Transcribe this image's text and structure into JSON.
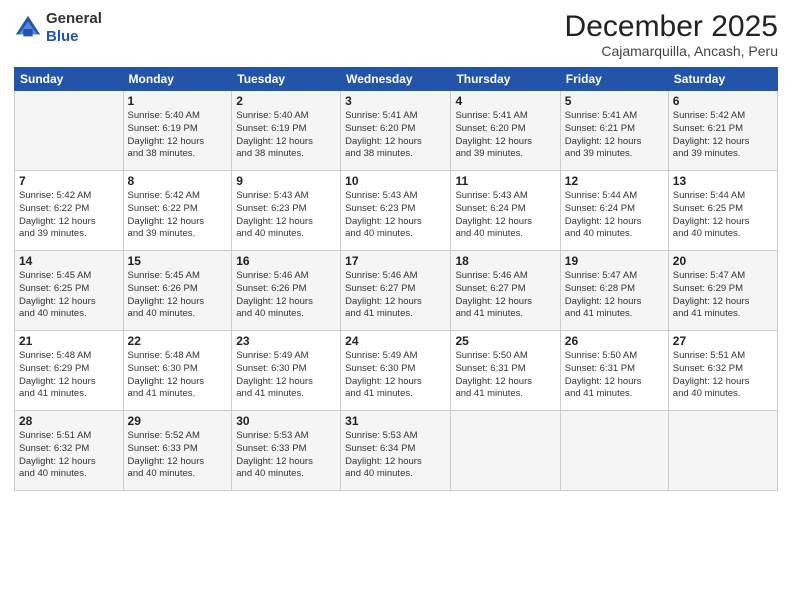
{
  "logo": {
    "general": "General",
    "blue": "Blue"
  },
  "title": "December 2025",
  "location": "Cajamarquilla, Ancash, Peru",
  "days_of_week": [
    "Sunday",
    "Monday",
    "Tuesday",
    "Wednesday",
    "Thursday",
    "Friday",
    "Saturday"
  ],
  "weeks": [
    [
      {
        "day": "",
        "info": ""
      },
      {
        "day": "1",
        "info": "Sunrise: 5:40 AM\nSunset: 6:19 PM\nDaylight: 12 hours\nand 38 minutes."
      },
      {
        "day": "2",
        "info": "Sunrise: 5:40 AM\nSunset: 6:19 PM\nDaylight: 12 hours\nand 38 minutes."
      },
      {
        "day": "3",
        "info": "Sunrise: 5:41 AM\nSunset: 6:20 PM\nDaylight: 12 hours\nand 38 minutes."
      },
      {
        "day": "4",
        "info": "Sunrise: 5:41 AM\nSunset: 6:20 PM\nDaylight: 12 hours\nand 39 minutes."
      },
      {
        "day": "5",
        "info": "Sunrise: 5:41 AM\nSunset: 6:21 PM\nDaylight: 12 hours\nand 39 minutes."
      },
      {
        "day": "6",
        "info": "Sunrise: 5:42 AM\nSunset: 6:21 PM\nDaylight: 12 hours\nand 39 minutes."
      }
    ],
    [
      {
        "day": "7",
        "info": "Sunrise: 5:42 AM\nSunset: 6:22 PM\nDaylight: 12 hours\nand 39 minutes."
      },
      {
        "day": "8",
        "info": "Sunrise: 5:42 AM\nSunset: 6:22 PM\nDaylight: 12 hours\nand 39 minutes."
      },
      {
        "day": "9",
        "info": "Sunrise: 5:43 AM\nSunset: 6:23 PM\nDaylight: 12 hours\nand 40 minutes."
      },
      {
        "day": "10",
        "info": "Sunrise: 5:43 AM\nSunset: 6:23 PM\nDaylight: 12 hours\nand 40 minutes."
      },
      {
        "day": "11",
        "info": "Sunrise: 5:43 AM\nSunset: 6:24 PM\nDaylight: 12 hours\nand 40 minutes."
      },
      {
        "day": "12",
        "info": "Sunrise: 5:44 AM\nSunset: 6:24 PM\nDaylight: 12 hours\nand 40 minutes."
      },
      {
        "day": "13",
        "info": "Sunrise: 5:44 AM\nSunset: 6:25 PM\nDaylight: 12 hours\nand 40 minutes."
      }
    ],
    [
      {
        "day": "14",
        "info": "Sunrise: 5:45 AM\nSunset: 6:25 PM\nDaylight: 12 hours\nand 40 minutes."
      },
      {
        "day": "15",
        "info": "Sunrise: 5:45 AM\nSunset: 6:26 PM\nDaylight: 12 hours\nand 40 minutes."
      },
      {
        "day": "16",
        "info": "Sunrise: 5:46 AM\nSunset: 6:26 PM\nDaylight: 12 hours\nand 40 minutes."
      },
      {
        "day": "17",
        "info": "Sunrise: 5:46 AM\nSunset: 6:27 PM\nDaylight: 12 hours\nand 41 minutes."
      },
      {
        "day": "18",
        "info": "Sunrise: 5:46 AM\nSunset: 6:27 PM\nDaylight: 12 hours\nand 41 minutes."
      },
      {
        "day": "19",
        "info": "Sunrise: 5:47 AM\nSunset: 6:28 PM\nDaylight: 12 hours\nand 41 minutes."
      },
      {
        "day": "20",
        "info": "Sunrise: 5:47 AM\nSunset: 6:29 PM\nDaylight: 12 hours\nand 41 minutes."
      }
    ],
    [
      {
        "day": "21",
        "info": "Sunrise: 5:48 AM\nSunset: 6:29 PM\nDaylight: 12 hours\nand 41 minutes."
      },
      {
        "day": "22",
        "info": "Sunrise: 5:48 AM\nSunset: 6:30 PM\nDaylight: 12 hours\nand 41 minutes."
      },
      {
        "day": "23",
        "info": "Sunrise: 5:49 AM\nSunset: 6:30 PM\nDaylight: 12 hours\nand 41 minutes."
      },
      {
        "day": "24",
        "info": "Sunrise: 5:49 AM\nSunset: 6:30 PM\nDaylight: 12 hours\nand 41 minutes."
      },
      {
        "day": "25",
        "info": "Sunrise: 5:50 AM\nSunset: 6:31 PM\nDaylight: 12 hours\nand 41 minutes."
      },
      {
        "day": "26",
        "info": "Sunrise: 5:50 AM\nSunset: 6:31 PM\nDaylight: 12 hours\nand 41 minutes."
      },
      {
        "day": "27",
        "info": "Sunrise: 5:51 AM\nSunset: 6:32 PM\nDaylight: 12 hours\nand 40 minutes."
      }
    ],
    [
      {
        "day": "28",
        "info": "Sunrise: 5:51 AM\nSunset: 6:32 PM\nDaylight: 12 hours\nand 40 minutes."
      },
      {
        "day": "29",
        "info": "Sunrise: 5:52 AM\nSunset: 6:33 PM\nDaylight: 12 hours\nand 40 minutes."
      },
      {
        "day": "30",
        "info": "Sunrise: 5:53 AM\nSunset: 6:33 PM\nDaylight: 12 hours\nand 40 minutes."
      },
      {
        "day": "31",
        "info": "Sunrise: 5:53 AM\nSunset: 6:34 PM\nDaylight: 12 hours\nand 40 minutes."
      },
      {
        "day": "",
        "info": ""
      },
      {
        "day": "",
        "info": ""
      },
      {
        "day": "",
        "info": ""
      }
    ]
  ]
}
